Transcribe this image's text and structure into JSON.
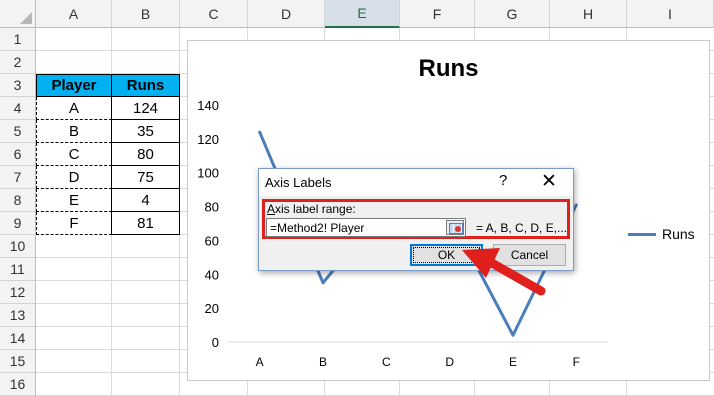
{
  "columns": [
    "A",
    "B",
    "C",
    "D",
    "E",
    "F",
    "G",
    "H",
    "I"
  ],
  "active_column": "E",
  "rows": [
    "1",
    "2",
    "3",
    "4",
    "5",
    "6",
    "7",
    "8",
    "9",
    "10",
    "11",
    "12",
    "13",
    "14",
    "15",
    "16"
  ],
  "table": {
    "header": [
      "Player",
      "Runs"
    ],
    "rows": [
      [
        "A",
        "124"
      ],
      [
        "B",
        "35"
      ],
      [
        "C",
        "80"
      ],
      [
        "D",
        "75"
      ],
      [
        "E",
        "4"
      ],
      [
        "F",
        "81"
      ]
    ]
  },
  "chart_data": {
    "type": "line",
    "title": "Runs",
    "categories": [
      "A",
      "B",
      "C",
      "D",
      "E",
      "F"
    ],
    "series": [
      {
        "name": "Runs",
        "values": [
          124,
          35,
          80,
          75,
          4,
          81
        ],
        "color": "#4a7ebb"
      }
    ],
    "ylim": [
      0,
      140
    ],
    "yticks": [
      "0",
      "20",
      "40",
      "60",
      "80",
      "100",
      "120",
      "140"
    ],
    "legend": "right",
    "grid": false
  },
  "dialog": {
    "title": "Axis Labels",
    "help_glyph": "?",
    "close_glyph": "✕",
    "range_label_underlined": "A",
    "range_label_rest": "xis label range:",
    "range_value": "=Method2! Player",
    "preview": "= A, B, C, D, E,...",
    "ok_label": "OK",
    "cancel_label": "Cancel"
  },
  "colors": {
    "header_fill": "#00b0f0",
    "highlight": "#e0201c",
    "series": "#4a7ebb"
  }
}
